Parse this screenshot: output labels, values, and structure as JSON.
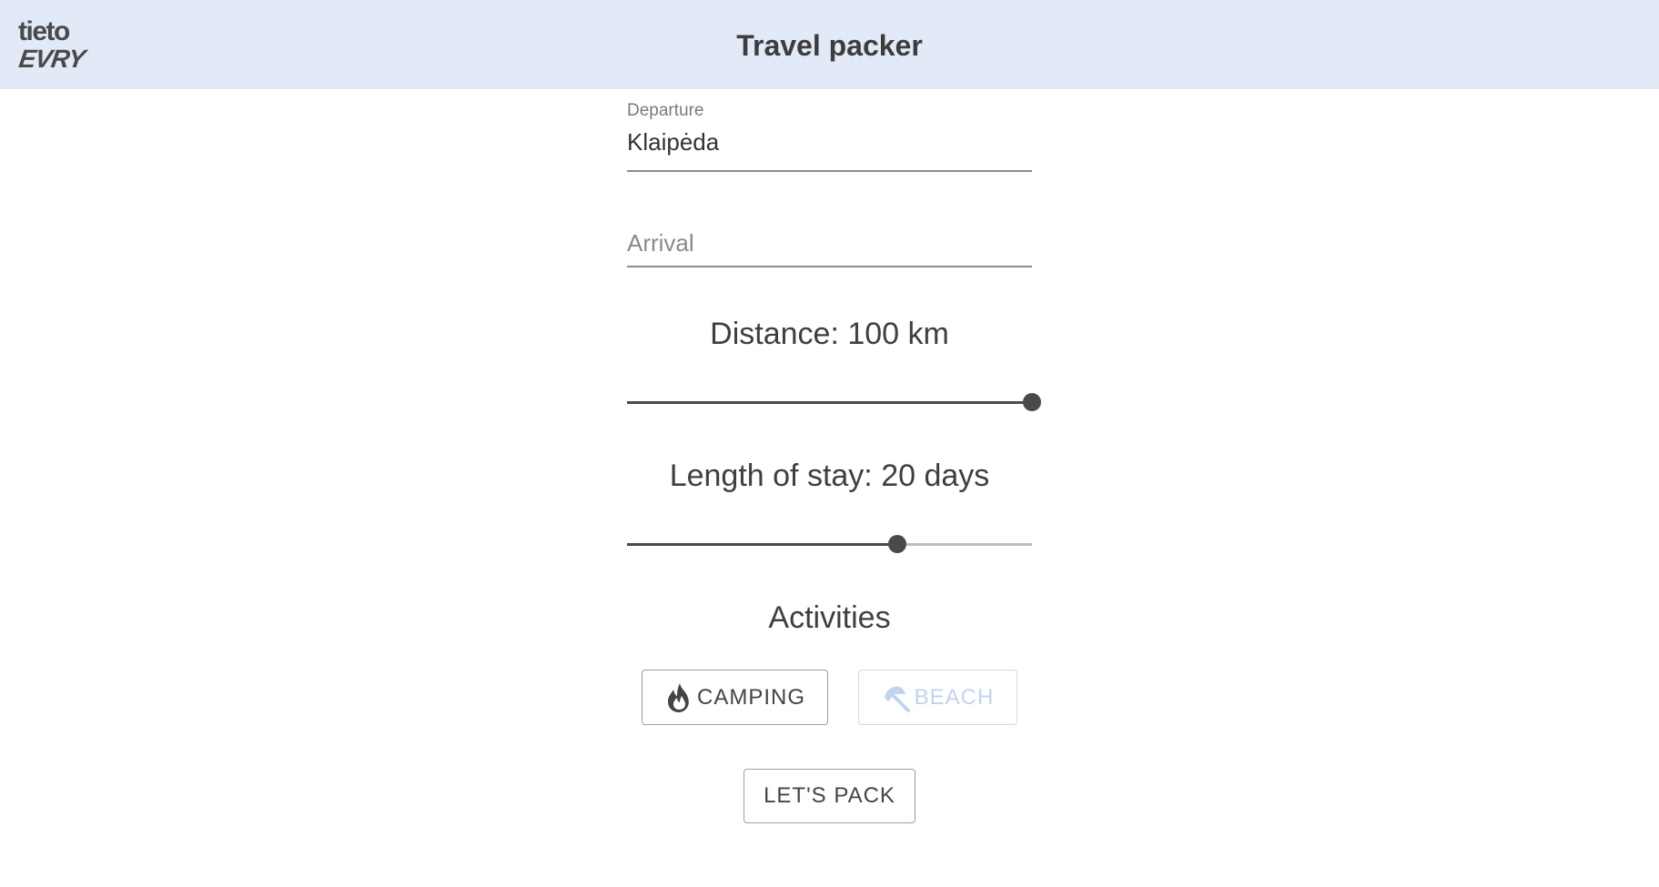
{
  "header": {
    "logo_line1": "tieto",
    "logo_line2": "EVRY",
    "title": "Travel packer"
  },
  "departure": {
    "label": "Departure",
    "value": "Klaipėda"
  },
  "arrival": {
    "placeholder": "Arrival",
    "value": ""
  },
  "distance": {
    "label": "Distance: 100 km",
    "value": 100,
    "fraction": 1.0
  },
  "stay": {
    "label": "Length of stay: 20 days",
    "value": 20,
    "fraction": 0.667
  },
  "activities": {
    "heading": "Activities",
    "camping_label": "CAMPING",
    "camping_icon": "fire-icon",
    "beach_label": "BEACH",
    "beach_icon": "beach-umbrella-icon",
    "beach_disabled": true
  },
  "actions": {
    "pack_label": "LET'S PACK"
  },
  "colors": {
    "header_bg": "#e2eaf7",
    "slider_active": "#4a4a4a",
    "slider_rail": "#bdbdbd",
    "disabled_text": "#bfd4ee"
  }
}
